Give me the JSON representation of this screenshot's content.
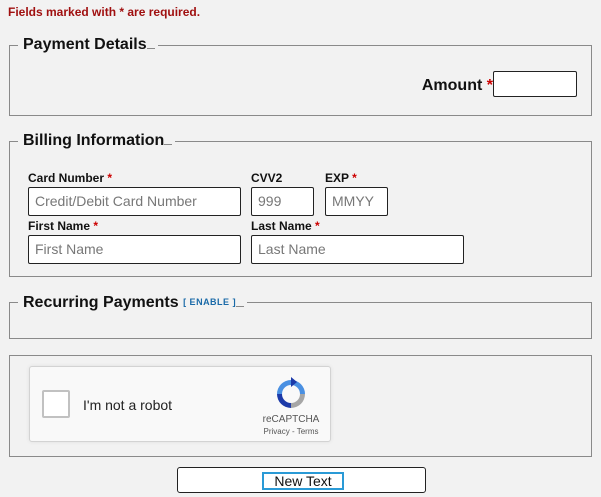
{
  "form": {
    "required_note": "Fields marked with * are required."
  },
  "payment": {
    "legend": "Payment Details",
    "amount_label": "Amount",
    "required_mark": "*",
    "amount_value": ""
  },
  "billing": {
    "legend": "Billing Information",
    "card_number_label": "Card Number",
    "card_number_placeholder": "Credit/Debit Card Number",
    "cvv2_label": "CVV2",
    "cvv2_placeholder": "999",
    "exp_label": "EXP",
    "exp_placeholder": "MMYY",
    "first_name_label": "First Name",
    "first_name_placeholder": "First Name",
    "last_name_label": "Last Name",
    "last_name_placeholder": "Last Name",
    "required_mark": "*"
  },
  "recurring": {
    "legend": "Recurring Payments",
    "enable_link": "[ ENABLE ]"
  },
  "captcha": {
    "checkbox_label": "I'm not a robot",
    "brand": "reCAPTCHA",
    "links": "Privacy - Terms",
    "logo_icon": "recaptcha-logo-icon"
  },
  "submit": {
    "label": "New Text"
  },
  "colors": {
    "required": "#cc0000",
    "note": "#a01010",
    "link": "#1a6aa8",
    "focus": "#2a9ad6"
  }
}
